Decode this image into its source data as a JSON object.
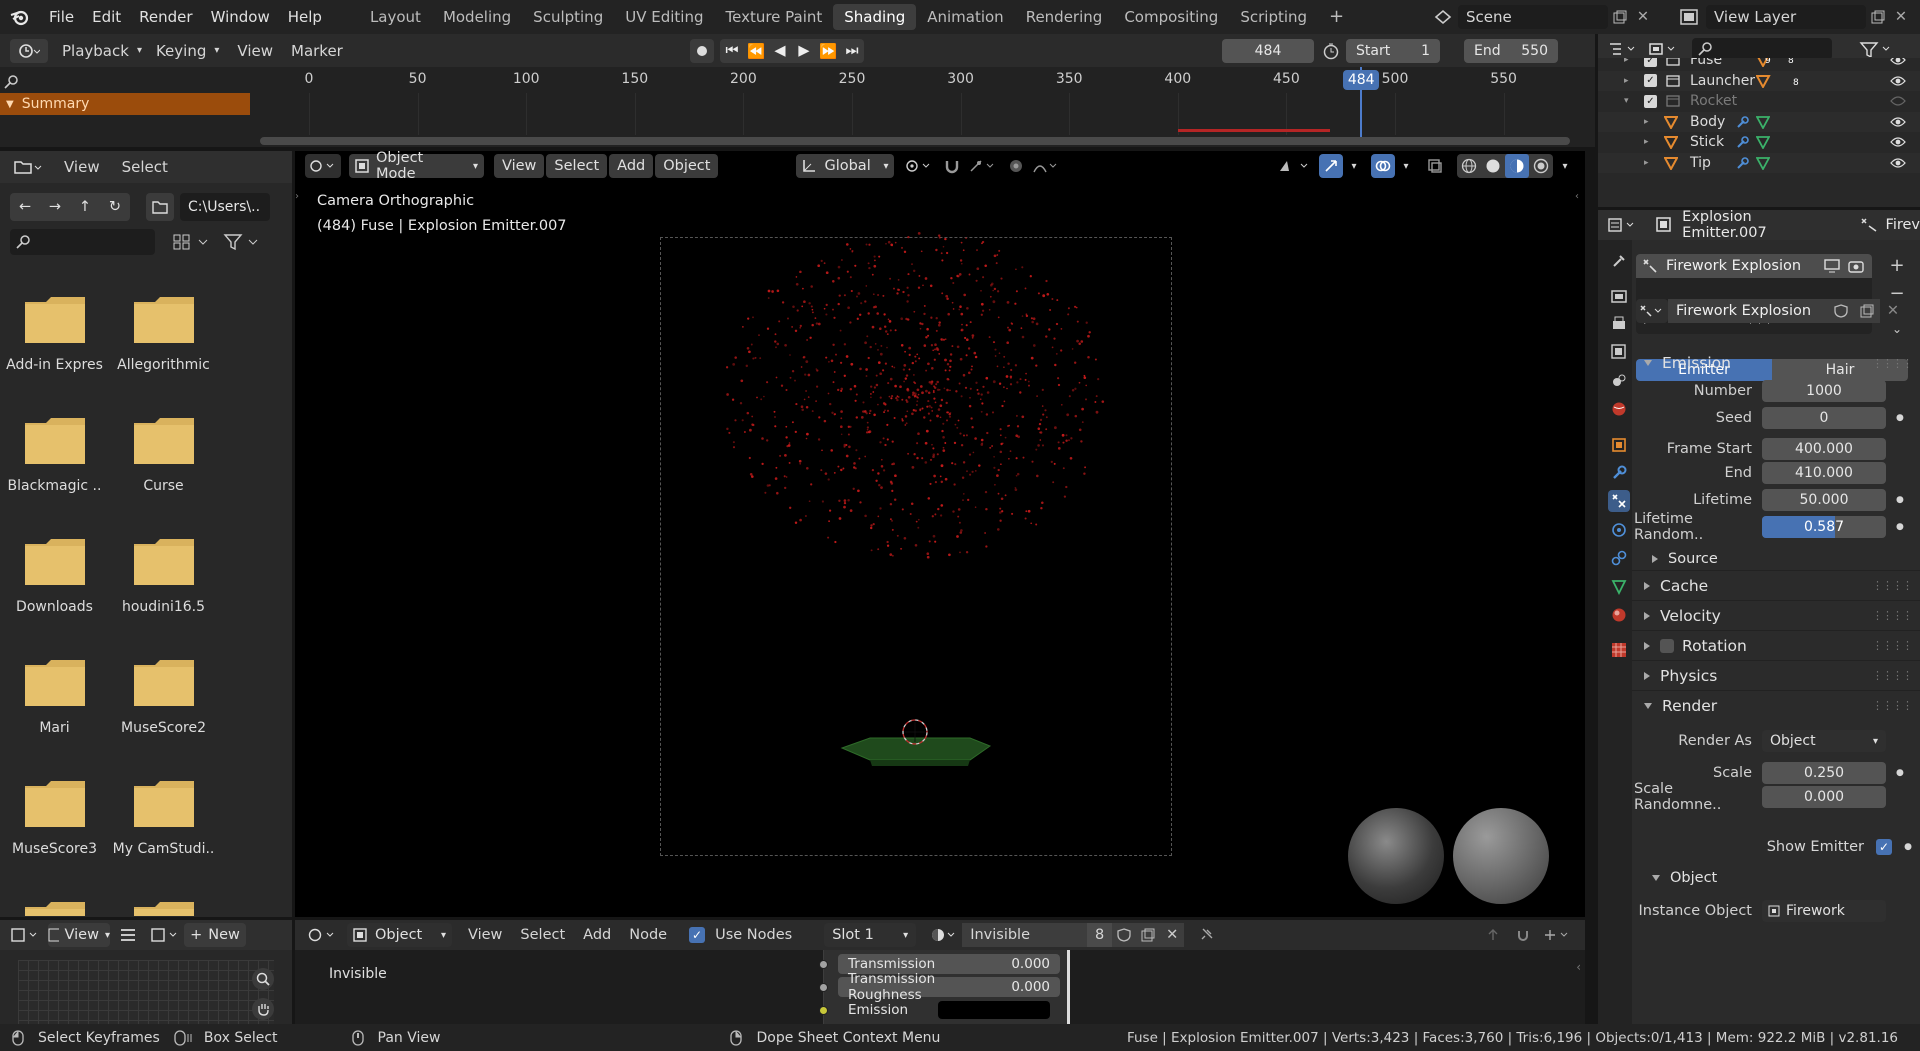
{
  "topbar": {
    "menus": [
      "File",
      "Edit",
      "Render",
      "Window",
      "Help"
    ],
    "workspaces": [
      "Layout",
      "Modeling",
      "Sculpting",
      "UV Editing",
      "Texture Paint",
      "Shading",
      "Animation",
      "Rendering",
      "Compositing",
      "Scripting"
    ],
    "active_workspace": "Shading",
    "scene": "Scene",
    "view_layer": "View Layer"
  },
  "timeline": {
    "menus": [
      "Playback",
      "Keying",
      "View",
      "Marker"
    ],
    "current_frame": "484",
    "start_label": "Start",
    "start_value": "1",
    "end_label": "End",
    "end_value": "550",
    "ruler": [
      "0",
      "50",
      "100",
      "150",
      "200",
      "250",
      "300",
      "350",
      "400",
      "450",
      "500",
      "550"
    ],
    "playhead_label": "484",
    "summary": "Summary"
  },
  "file_browser": {
    "menus": [
      "View",
      "Select"
    ],
    "path": "C:\\Users\\..",
    "folders": [
      "Add-in Expres",
      "Allegorithmic",
      "Blackmagic ..",
      "Curse",
      "Downloads",
      "houdini16.5",
      "Mari",
      "MuseScore2",
      "MuseScore3",
      "My CamStudi.."
    ]
  },
  "viewport": {
    "mode": "Object Mode",
    "menus": [
      "View",
      "Select",
      "Add",
      "Object"
    ],
    "orientation": "Global",
    "overlay_title": "Camera Orthographic",
    "overlay_subtitle": "(484) Fuse | Explosion Emitter.007"
  },
  "outliner": {
    "items": [
      {
        "name": "Fuse",
        "dim": false
      },
      {
        "name": "Launcher",
        "dim": false
      },
      {
        "name": "Rocket",
        "dim": true
      },
      {
        "name": "Body",
        "dim": false
      },
      {
        "name": "Stick",
        "dim": false
      },
      {
        "name": "Tip",
        "dim": false
      }
    ],
    "badges": [
      "9",
      "8",
      "8"
    ]
  },
  "properties": {
    "object_name": "Explosion Emitter.007",
    "tab_right": "Firev",
    "particle_system": "Firework Explosion",
    "settings_name": "Firework Explosion",
    "type_emitter": "Emitter",
    "type_hair": "Hair",
    "emission": {
      "title": "Emission",
      "number_label": "Number",
      "number": "1000",
      "seed_label": "Seed",
      "seed": "0",
      "frame_start_label": "Frame Start",
      "frame_start": "400.000",
      "end_label": "End",
      "end": "410.000",
      "lifetime_label": "Lifetime",
      "lifetime": "50.000",
      "lifetime_random_label": "Lifetime Random..",
      "lifetime_random": "0.587",
      "lifetime_random_fraction": 0.587,
      "source": "Source"
    },
    "panels": [
      "Cache",
      "Velocity",
      "Rotation",
      "Physics"
    ],
    "render": {
      "title": "Render",
      "render_as_label": "Render As",
      "render_as": "Object",
      "scale_label": "Scale",
      "scale": "0.250",
      "scale_random_label": "Scale Randomne..",
      "scale_random": "0.000",
      "show_emitter": "Show Emitter",
      "object_sub": "Object",
      "instance_label": "Instance Object",
      "instance": "Firework"
    }
  },
  "node_editor": {
    "left_view": "View",
    "left_new": "New",
    "object_type": "Object",
    "menus": [
      "View",
      "Select",
      "Add",
      "Node"
    ],
    "use_nodes": "Use Nodes",
    "slot": "Slot 1",
    "material": "Invisible",
    "users": "8",
    "node_label": "Invisible",
    "sockets": [
      {
        "name": "Transmission",
        "value": "0.000"
      },
      {
        "name": "Transmission Roughness",
        "value": "0.000"
      },
      {
        "name": "Emission",
        "value": ""
      }
    ]
  },
  "statusbar": {
    "items": [
      "Select Keyframes",
      "Box Select",
      "Pan View",
      "Dope Sheet Context Menu"
    ],
    "stats": "Fuse | Explosion Emitter.007 | Verts:3,423 | Faces:3,760 | Tris:6,196 | Objects:0/1,413 | Mem: 922.2 MiB | v2.81.16"
  },
  "colors": {
    "accent": "#4772b3",
    "folder": "#e6c16c",
    "particle": "#c21a1a",
    "summary": "#9b4c0c"
  }
}
